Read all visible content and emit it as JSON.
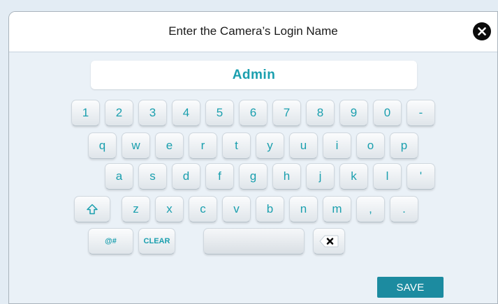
{
  "dialog": {
    "title": "Enter the Camera’s Login Name",
    "close_icon": "close-icon",
    "input_value": "Admin",
    "save_label": "SAVE"
  },
  "keyboard": {
    "row1": [
      "1",
      "2",
      "3",
      "4",
      "5",
      "6",
      "7",
      "8",
      "9",
      "0",
      "-"
    ],
    "row2": [
      "q",
      "w",
      "e",
      "r",
      "t",
      "y",
      "u",
      "i",
      "o",
      "p"
    ],
    "row3": [
      "a",
      "s",
      "d",
      "f",
      "g",
      "h",
      "j",
      "k",
      "l",
      "'"
    ],
    "row4_keys": [
      "z",
      "x",
      "c",
      "v",
      "b",
      "n",
      "m",
      ",",
      "."
    ],
    "shift_icon": "shift-arrow-icon",
    "symbols_label": "@#",
    "clear_label": "CLEAR",
    "backspace_icon": "backspace-icon"
  },
  "colors": {
    "accent": "#1a9fae",
    "save_button": "#1c8ba0",
    "background": "#eaf1f7"
  }
}
